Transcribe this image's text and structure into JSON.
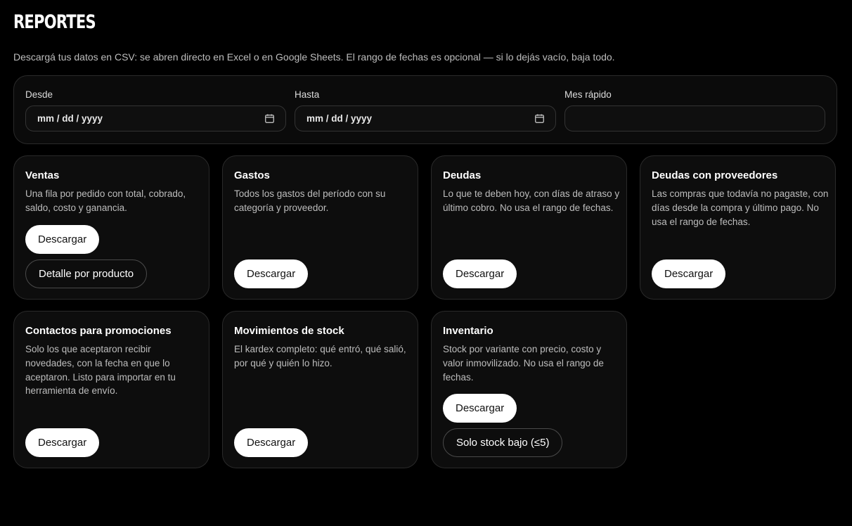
{
  "page": {
    "title": "REPORTES",
    "subtitle": "Descargá tus datos en CSV: se abren directo en Excel o en Google Sheets. El rango de fechas es opcional — si lo dejás vacío, baja todo."
  },
  "filters": {
    "desde": {
      "label": "Desde",
      "value": "mm / dd / yyyy"
    },
    "hasta": {
      "label": "Hasta",
      "value": "mm / dd / yyyy"
    },
    "mes_rapido": {
      "label": "Mes rápido",
      "value": ""
    }
  },
  "reports": [
    {
      "title": "Ventas",
      "description": "Una fila por pedido con total, cobrado, saldo, costo y ganancia.",
      "primary_button": "Descargar",
      "secondary_button": "Detalle por producto"
    },
    {
      "title": "Gastos",
      "description": "Todos los gastos del período con su categoría y proveedor.",
      "primary_button": "Descargar"
    },
    {
      "title": "Deudas",
      "description": "Lo que te deben hoy, con días de atraso y último cobro. No usa el rango de fechas.",
      "primary_button": "Descargar"
    },
    {
      "title": "Deudas con proveedores",
      "description": "Las compras que todavía no pagaste, con días desde la compra y último pago. No usa el rango de fechas.",
      "primary_button": "Descargar"
    },
    {
      "title": "Contactos para promociones",
      "description": "Solo los que aceptaron recibir novedades, con la fecha en que lo aceptaron. Listo para importar en tu herramienta de envío.",
      "primary_button": "Descargar"
    },
    {
      "title": "Movimientos de stock",
      "description": "El kardex completo: qué entró, qué salió, por qué y quién lo hizo.",
      "primary_button": "Descargar"
    },
    {
      "title": "Inventario",
      "description": "Stock por variante con precio, costo y valor inmovilizado. No usa el rango de fechas.",
      "primary_button": "Descargar",
      "secondary_button": "Solo stock bajo (≤5)"
    }
  ],
  "icons": {
    "calendar": "calendar-icon"
  },
  "colors": {
    "background": "#000000",
    "card": "#0d0d0d",
    "border": "#2a2a2a",
    "primary_button": "#ffffff",
    "text": "#ffffff",
    "muted_text": "#bdbdbd"
  }
}
